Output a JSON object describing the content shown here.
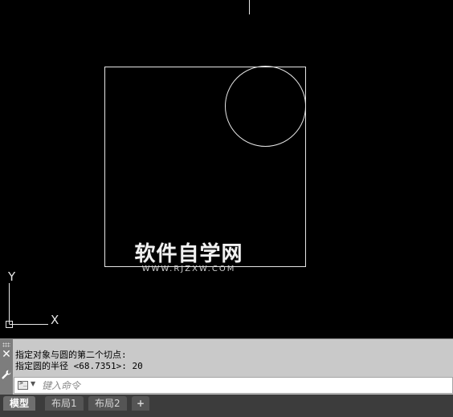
{
  "watermark": {
    "main": "软件自学网",
    "sub": "WWW.RJZXW.COM"
  },
  "canvas": {
    "ucs_y_label": "Y",
    "ucs_x_label": "X"
  },
  "command": {
    "history": [
      "指定对象与圆的第二个切点:",
      "指定圆的半径 <68.7351>: 20"
    ],
    "input_value": "",
    "input_placeholder": "键入命令",
    "prompt_icon_glyph": ">_"
  },
  "tabs": [
    {
      "label": "模型",
      "active": true
    },
    {
      "label": "布局1",
      "active": false
    },
    {
      "label": "布局2",
      "active": false
    }
  ],
  "add_tab_label": "+",
  "colors": {
    "canvas_bg": "#000000",
    "geometry": "#e6e6e6",
    "panel_bg": "#c9c9c9"
  }
}
